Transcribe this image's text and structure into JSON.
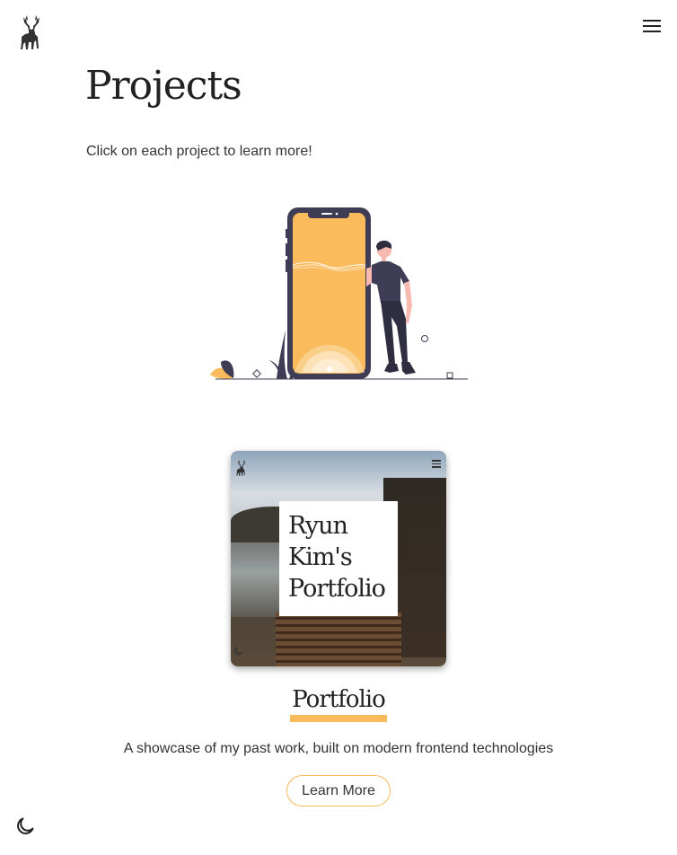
{
  "header": {
    "logo_icon": "deer-icon",
    "menu_icon": "hamburger-menu-icon"
  },
  "main": {
    "title": "Projects",
    "intro": "Click on each project to learn more!",
    "illustration_icon": "person-leaning-on-phone-illustration"
  },
  "project": {
    "thumbnail_title": "Ryun Kim's Portfolio",
    "thumbnail_title_lines": [
      "Ryun",
      "Kim's",
      "Portfolio"
    ],
    "name": "Portfolio",
    "description": "A showcase of my past work, built on modern frontend technologies",
    "button_label": "Learn More"
  },
  "footer": {
    "theme_toggle_icon": "moon-icon"
  },
  "colors": {
    "accent": "#f9bb5c",
    "text": "#333333",
    "heading": "#222222",
    "illustration_dark": "#3f3d56"
  }
}
